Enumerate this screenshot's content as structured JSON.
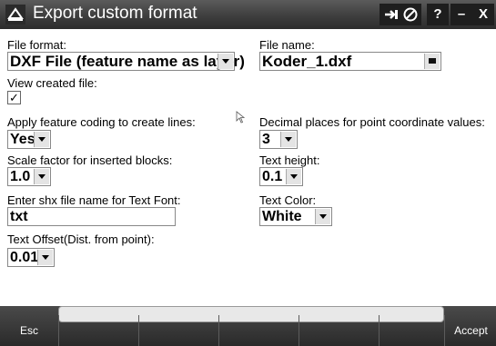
{
  "titlebar": {
    "title": "Export custom format",
    "app_icon": "trimble-dome-icon",
    "help_label": "?",
    "minimize_label": "–",
    "close_label": "X"
  },
  "form": {
    "file_format": {
      "label": "File format:",
      "value": "DXF File (feature name as layer)"
    },
    "file_name": {
      "label": "File name:",
      "value": "Koder_1.dxf"
    },
    "view_created": {
      "label": "View created file:",
      "checked": true,
      "check_glyph": "✓"
    },
    "feature_coding": {
      "label": "Apply feature coding to create lines:",
      "value": "Yes"
    },
    "decimal_places": {
      "label": "Decimal places for point coordinate values:",
      "value": "3"
    },
    "scale_factor": {
      "label": "Scale factor for inserted blocks:",
      "value": "1.0"
    },
    "text_height": {
      "label": "Text height:",
      "value": "0.1"
    },
    "shx_font": {
      "label": "Enter shx file name for Text Font:",
      "value": "txt"
    },
    "text_color": {
      "label": "Text Color:",
      "value": "White"
    },
    "text_offset": {
      "label": "Text Offset(Dist. from point):",
      "value": "0.01"
    }
  },
  "softkeys": {
    "esc_label": "Esc",
    "accept_label": "Accept"
  }
}
